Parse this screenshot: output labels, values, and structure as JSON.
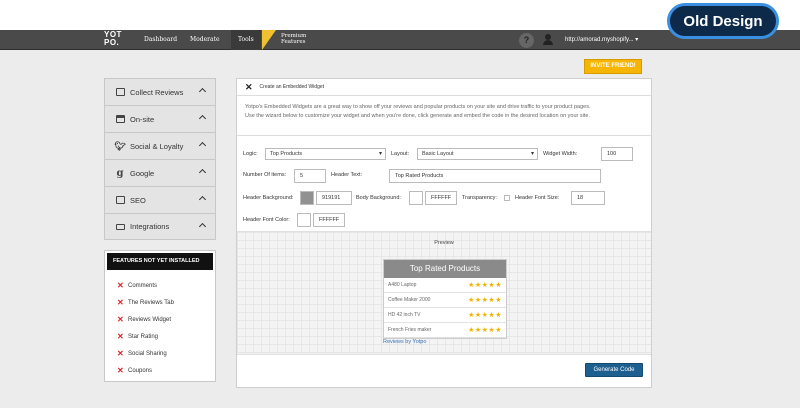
{
  "badge": "Old Design",
  "nav": {
    "logo_line1": "YOT",
    "logo_line2": "PO.",
    "items": [
      "Dashboard",
      "Moderate",
      "Tools"
    ],
    "premium_line1": "Premium",
    "premium_line2": "Features",
    "help": "?",
    "shop": "http://amorad.myshopify... ▾"
  },
  "invite_label": "INVITE FRIEND!",
  "sidebar": {
    "items": [
      {
        "label": "Collect Reviews",
        "icon": "reviews-icon"
      },
      {
        "label": "On-site",
        "icon": "onsite-icon"
      },
      {
        "label": "Social & Loyalty",
        "icon": "twitter-icon"
      },
      {
        "label": "Google",
        "icon": "google-icon"
      },
      {
        "label": "SEO",
        "icon": "seo-icon"
      },
      {
        "label": "Integrations",
        "icon": "integrations-icon"
      }
    ]
  },
  "not_installed": {
    "title": "FEATURES NOT YET INSTALLED",
    "items": [
      "Comments",
      "The Reviews Tab",
      "Reviews Widget",
      "Star Rating",
      "Social Sharing",
      "Coupons"
    ]
  },
  "panel": {
    "title": "Create an Embedded Widget",
    "desc_line1": "Yotpo's Embedded Widgets are a great way to show off your reviews and popular products on your site and drive traffic to your product pages.",
    "desc_line2": "Use the wizard below to customize your widget and when you're done, click generate and embed the code in the desired location on your site.",
    "logic_label": "Logic:",
    "logic_value": "Top Products",
    "layout_label": "Layout:",
    "layout_value": "Basic Layout",
    "width_label": "Widget Width:",
    "width_value": "100",
    "items_label": "Number Of items:",
    "items_value": "5",
    "header_text_label": "Header Text:",
    "header_text_value": "Top Rated Products",
    "header_bg_label": "Header Background:",
    "header_bg_value": "919191",
    "body_bg_label": "Body Background:",
    "body_bg_value": "FFFFFF",
    "transparency_label": "Transparency:",
    "font_size_label": "Header Font Size:",
    "font_size_value": "18",
    "font_color_label": "Header Font Color:",
    "font_color_value": "FFFFFF",
    "preview_label": "Preview",
    "widget_title": "Top Rated Products",
    "products": [
      "A480 Laptop",
      "Coffee Maker 2000",
      "HD 42 inch TV",
      "French Fries maker"
    ],
    "stars": "★★★★★",
    "footer_link": "Reviews by Yotpo",
    "generate_label": "Generate Code"
  },
  "colors": {
    "accent": "#f6b500",
    "header_bg": "#919191",
    "button": "#1d5f8f",
    "badge_border": "#3a8fe0"
  }
}
